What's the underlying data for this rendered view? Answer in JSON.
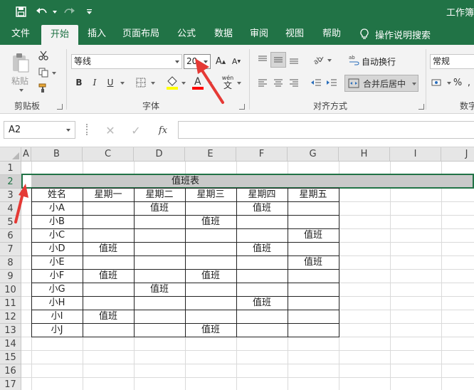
{
  "window": {
    "title": "工作簿"
  },
  "tabs": [
    {
      "label": "文件"
    },
    {
      "label": "开始"
    },
    {
      "label": "插入"
    },
    {
      "label": "页面布局"
    },
    {
      "label": "公式"
    },
    {
      "label": "数据"
    },
    {
      "label": "审阅"
    },
    {
      "label": "视图"
    },
    {
      "label": "帮助"
    }
  ],
  "tell_me": {
    "label": "操作说明搜索",
    "icon": "lightbulb-icon"
  },
  "ribbon": {
    "clipboard": {
      "label": "剪贴板",
      "paste_label": "粘贴"
    },
    "font": {
      "label": "字体",
      "name": "等线",
      "size": "20",
      "bold": "B",
      "italic": "I",
      "underline": "U",
      "accent_color": "#ff0000",
      "fill_color": "#ffff00"
    },
    "alignment": {
      "label": "对齐方式",
      "wrap_label": "自动换行",
      "merge_label": "合并后居中"
    },
    "number": {
      "label": "数字",
      "format": "常规"
    }
  },
  "formula_bar": {
    "name_box": "A2",
    "fx": "fx",
    "value": ""
  },
  "sheet": {
    "columns": [
      "A",
      "B",
      "C",
      "D",
      "E",
      "F",
      "G",
      "H",
      "I",
      "J"
    ],
    "rows": [
      "1",
      "2",
      "3",
      "4",
      "5",
      "6",
      "7",
      "8",
      "9",
      "10",
      "11",
      "12",
      "13",
      "14",
      "15",
      "16",
      "17"
    ],
    "selected_row": "2",
    "merged_title": "值班表",
    "header": [
      "姓名",
      "星期一",
      "星期二",
      "星期三",
      "星期四",
      "星期五"
    ],
    "table": [
      [
        "小A",
        "",
        "值班",
        "",
        "值班",
        ""
      ],
      [
        "小B",
        "",
        "",
        "值班",
        "",
        ""
      ],
      [
        "小C",
        "",
        "",
        "",
        "",
        "值班"
      ],
      [
        "小D",
        "值班",
        "",
        "",
        "值班",
        ""
      ],
      [
        "小E",
        "",
        "",
        "",
        "",
        "值班"
      ],
      [
        "小F",
        "值班",
        "",
        "值班",
        "",
        ""
      ],
      [
        "小G",
        "",
        "值班",
        "",
        "",
        ""
      ],
      [
        "小H",
        "",
        "",
        "",
        "值班",
        ""
      ],
      [
        "小I",
        "值班",
        "",
        "",
        "",
        ""
      ],
      [
        "小J",
        "",
        "",
        "值班",
        "",
        ""
      ]
    ]
  },
  "theme": {
    "accent": "#217346",
    "annotation": "#e53935"
  }
}
